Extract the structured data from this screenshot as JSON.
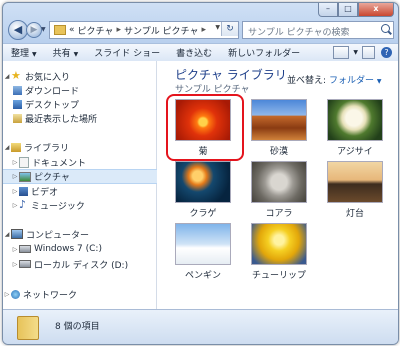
{
  "window": {
    "caption_buttons": {
      "minimize": "–",
      "maximize": "□",
      "close": "x"
    }
  },
  "address": {
    "overflow": "«",
    "crumbs": [
      "ピクチャ",
      "サンプル ピクチャ"
    ],
    "separator": "▸",
    "refresh_glyph": "↻"
  },
  "search": {
    "placeholder": "サンプル ピクチャの検索"
  },
  "toolbar": {
    "organize": "整理",
    "share": "共有",
    "slideshow": "スライド ショー",
    "burn": "書き込む",
    "new_folder": "新しいフォルダー",
    "help": "?"
  },
  "nav": {
    "favorites": "お気に入り",
    "downloads": "ダウンロード",
    "desktop": "デスクトップ",
    "recent": "最近表示した場所",
    "libraries": "ライブラリ",
    "documents": "ドキュメント",
    "pictures": "ピクチャ",
    "videos": "ビデオ",
    "music": "ミュージック",
    "computer": "コンピューター",
    "drive_c": "Windows 7 (C:)",
    "drive_d": "ローカル ディスク (D:)",
    "network": "ネットワーク"
  },
  "content": {
    "title": "ピクチャ ライブラリ",
    "subtitle": "サンプル ピクチャ",
    "arrange_label": "並べ替え:",
    "arrange_value": "フォルダー",
    "items": [
      "菊",
      "砂漠",
      "アジサイ",
      "クラゲ",
      "コアラ",
      "灯台",
      "ペンギン",
      "チューリップ"
    ]
  },
  "status": {
    "count": "8 個の項目"
  },
  "colors": {
    "selection_highlight": "#e4141d",
    "library_title": "#1e3f8a"
  }
}
